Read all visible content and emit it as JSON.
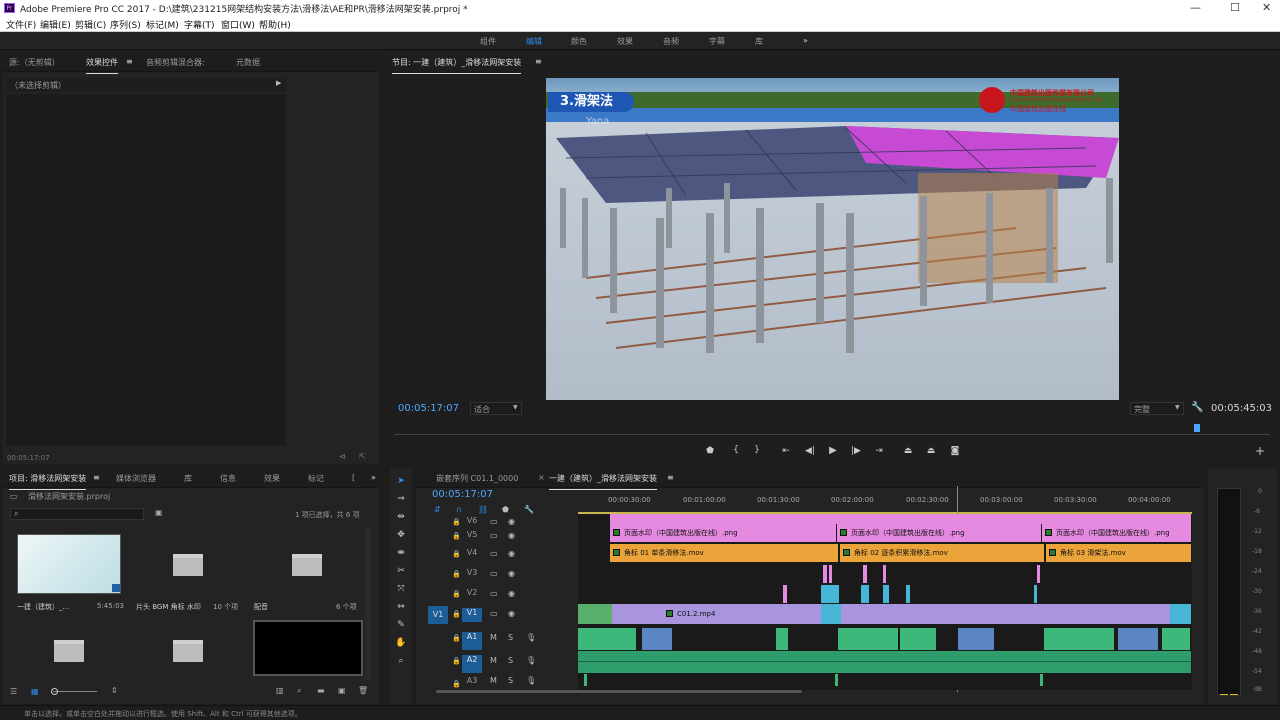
{
  "window": {
    "title": "Adobe Premiere Pro CC 2017 - D:\\建筑\\231215网架结构安装方法\\滑移法\\AE和PR\\滑移法网架安装.prproj *",
    "icon": "Pr",
    "minimize": "—",
    "maximize": "☐",
    "close": "✕"
  },
  "menu": [
    "文件(F)",
    "编辑(E)",
    "剪辑(C)",
    "序列(S)",
    "标记(M)",
    "字幕(T)",
    "窗口(W)",
    "帮助(H)"
  ],
  "workspaces": {
    "items": [
      "组件",
      "编辑",
      "颜色",
      "效果",
      "音频",
      "字幕",
      "库"
    ],
    "active": "编辑",
    "more": "»"
  },
  "source_panel": {
    "tabs": [
      "源:（无剪辑）",
      "效果控件",
      "音频剪辑混合器:",
      "元数据"
    ],
    "active": "效果控件",
    "menu_icon": "≡",
    "no_clip": "（未选择剪辑）",
    "timecode": "00:05:17:07"
  },
  "program": {
    "tab": "节目: 一建（建筑）_滑移法网架安装",
    "menu_icon": "≡",
    "timecode_left": "00:05:17:07",
    "fit": "适合",
    "quality": "完整",
    "timecode_right": "00:05:45:03",
    "video": {
      "title_badge": "3.滑架法",
      "publisher": "中国建筑出版传媒有限公司",
      "publisher_en": "China Architecture Publishing & Media Co.,Ltd",
      "watermark_top": "Yana",
      "site_name": "中国建筑出版在线"
    },
    "controls": [
      "marker-icon",
      "mark-in-icon",
      "mark-out-icon",
      "go-to-in-icon",
      "step-back-icon",
      "play-icon",
      "step-forward-icon",
      "go-to-out-icon",
      "lift-icon",
      "extract-icon",
      "export-frame-icon"
    ],
    "add": "+"
  },
  "project": {
    "tabs": [
      "项目: 滑移法网架安装",
      "媒体浏览器",
      "库",
      "信息",
      "效果",
      "标记",
      "["
    ],
    "active": "项目: 滑移法网架安装",
    "menu_icon": "≡",
    "more": "»",
    "file": "滑移法网架安装.prproj",
    "search_placeholder": "",
    "selection": "1 项已选择，共 6 项",
    "items": [
      {
        "name": "一建（建筑）_...",
        "meta": "5:45:03",
        "kind": "sequence"
      },
      {
        "name": "片头 BGM 角标 水印",
        "meta": "10 个项",
        "kind": "bin"
      },
      {
        "name": "配音",
        "meta": "6 个项",
        "kind": "bin"
      },
      {
        "name": "",
        "meta": "",
        "kind": "bin"
      },
      {
        "name": "",
        "meta": "",
        "kind": "bin"
      },
      {
        "name": "",
        "meta": "",
        "kind": "black"
      }
    ]
  },
  "timeline": {
    "tabs": [
      "嵌套序列 C01.1_0000",
      "一建（建筑）_滑移法网架安装"
    ],
    "close": "×",
    "active": "一建（建筑）_滑移法网架安装",
    "menu_icon": "≡",
    "timecode": "00:05:17:07",
    "ruler": [
      "00:00:30:00",
      "00:01:00:00",
      "00:01:30:00",
      "00:02:00:00",
      "00:02:30:00",
      "00:03:00:00",
      "00:03:30:00",
      "00:04:00:00"
    ],
    "video_tracks": [
      "V6",
      "V5",
      "V4",
      "V3",
      "V2",
      "V1"
    ],
    "audio_tracks": [
      "A1",
      "A2",
      "A3"
    ],
    "source_v": "V1",
    "source_a": "A1",
    "clips": {
      "v5": [
        "页面水印（中国建筑出版在线）.png",
        "页面水印（中国建筑出版在线）.png",
        "页面水印（中国建筑出版在线）.png"
      ],
      "v4": [
        "角标 01 单条滑移法.mov",
        "角标 02 逐条积累滑移法.mov",
        "角标 03 滑架法.mov"
      ],
      "v1": "C01.2.mp4"
    },
    "audio_letters": [
      "M",
      "S"
    ]
  },
  "meter": {
    "scale": [
      "0",
      "-6",
      "-12",
      "-18",
      "-24",
      "-30",
      "-36",
      "-42",
      "-48",
      "-54",
      "dB"
    ]
  },
  "status": "单击以选择，或单击空白处并拖动以进行框选。使用 Shift、Alt 和 Ctrl 可获得其他选项。",
  "colors": {
    "accent": "#2d8ceb",
    "timecode": "#4ca5ff",
    "v5": "#e58ae0",
    "v4": "#eaa43a",
    "v1": "#a895dd",
    "audio": "#3db77a"
  }
}
